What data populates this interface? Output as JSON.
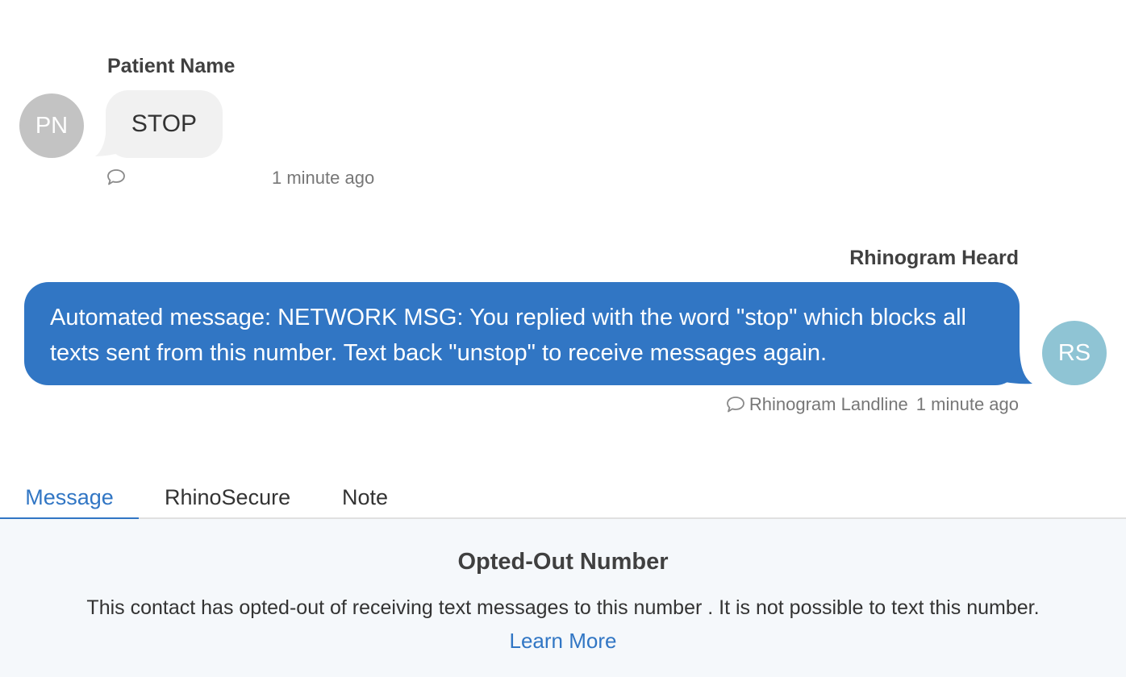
{
  "incoming": {
    "sender_name": "Patient Name",
    "avatar_initials": "PN",
    "text": "STOP",
    "timestamp": "1 minute ago"
  },
  "outgoing": {
    "sender_name": "Rhinogram Heard",
    "avatar_initials": "RS",
    "text": "Automated message: NETWORK MSG: You replied with the word \"stop\" which blocks all texts sent from this number. Text back \"unstop\" to receive messages again.",
    "channel": "Rhinogram Landline",
    "timestamp": "1 minute ago"
  },
  "tabs": [
    {
      "label": "Message",
      "active": true
    },
    {
      "label": "RhinoSecure",
      "active": false
    },
    {
      "label": "Note",
      "active": false
    }
  ],
  "opt_out": {
    "title": "Opted-Out Number",
    "description": "This contact has opted-out of receiving text messages to this number . It is not possible to text this number.",
    "link_label": "Learn More"
  },
  "colors": {
    "accent": "#3176c4",
    "incoming_bubble": "#f1f1f1",
    "avatar_patient": "#c3c3c3",
    "avatar_staff": "#8fc4d4",
    "panel_background": "#f5f8fb"
  },
  "icons": {
    "message_channel": "chat-bubble-icon"
  }
}
